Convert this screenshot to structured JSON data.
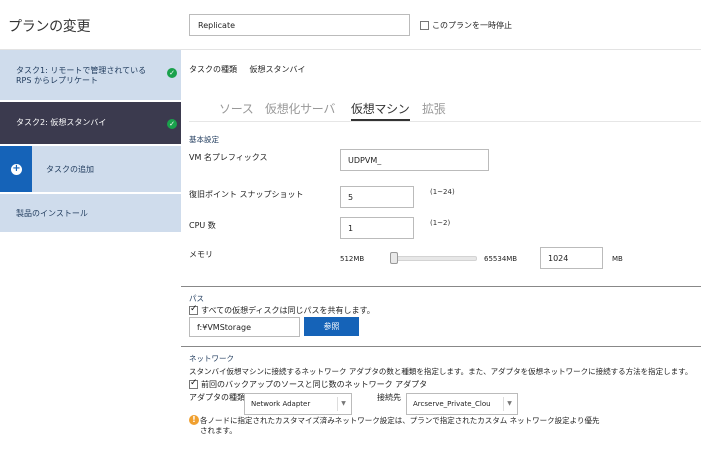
{
  "header": {
    "title": "プランの変更",
    "plan_name": "Replicate",
    "pause_label": "このプランを一時停止"
  },
  "sidebar": {
    "items": [
      {
        "label_line1": "タスク1: リモートで管理されている",
        "label_line2": "RPS からレプリケート",
        "status": "completed"
      },
      {
        "label": "タスク2: 仮想スタンバイ",
        "status": "completed"
      },
      {
        "label": "タスクの追加"
      },
      {
        "label": "製品のインストール"
      }
    ]
  },
  "task": {
    "type_label": "タスクの種類",
    "type_value": "仮想スタンバイ"
  },
  "tabs": [
    "ソース",
    "仮想化サーバ",
    "仮想マシン",
    "拡張"
  ],
  "active_tab": "仮想マシン",
  "basic": {
    "section_title": "基本設定",
    "vm_prefix_label": "VM 名プレフィックス",
    "vm_prefix_value": "UDPVM_",
    "snapshot_label": "復旧ポイント スナップショット",
    "snapshot_value": "5",
    "snapshot_range": "(1~24)",
    "cpu_label": "CPU 数",
    "cpu_value": "1",
    "cpu_range": "(1~2)",
    "memory_label": "メモリ",
    "memory_min": "512MB",
    "memory_max": "65534MB",
    "memory_value": "1024",
    "memory_unit": "MB",
    "memory_slider_level": 0.008
  },
  "path": {
    "section_title": "パス",
    "share_label": "すべての仮想ディスクは同じパスを共有します。",
    "share_checked": true,
    "path_value": "f:¥VMStorage",
    "browse_label": "参照"
  },
  "network": {
    "section_title": "ネットワーク",
    "description": "スタンバイ仮想マシンに接続するネットワーク アダプタの数と種類を指定します。また、アダプタを仮想ネットワークに接続する方法を指定します。",
    "same_as_source_label": "前回のバックアップのソースと同じ数のネットワーク アダプタ",
    "same_as_source_checked": true,
    "adapter_type_label": "アダプタの種類",
    "adapter_type_value": "Network Adapter",
    "connect_label": "接続先",
    "connect_value": "Arcserve_Private_Clou",
    "warning": "各ノードに指定されたカスタマイズ済みネットワーク設定は、プランで指定されたカスタム ネットワーク設定より優先されます。"
  },
  "colors": {
    "sidebar_bg": "#cfdcec",
    "sidebar_active_bg": "#3b3a4e",
    "accent": "#1563b8",
    "ok_green": "#1aa14c",
    "warning": "#f0a030"
  }
}
